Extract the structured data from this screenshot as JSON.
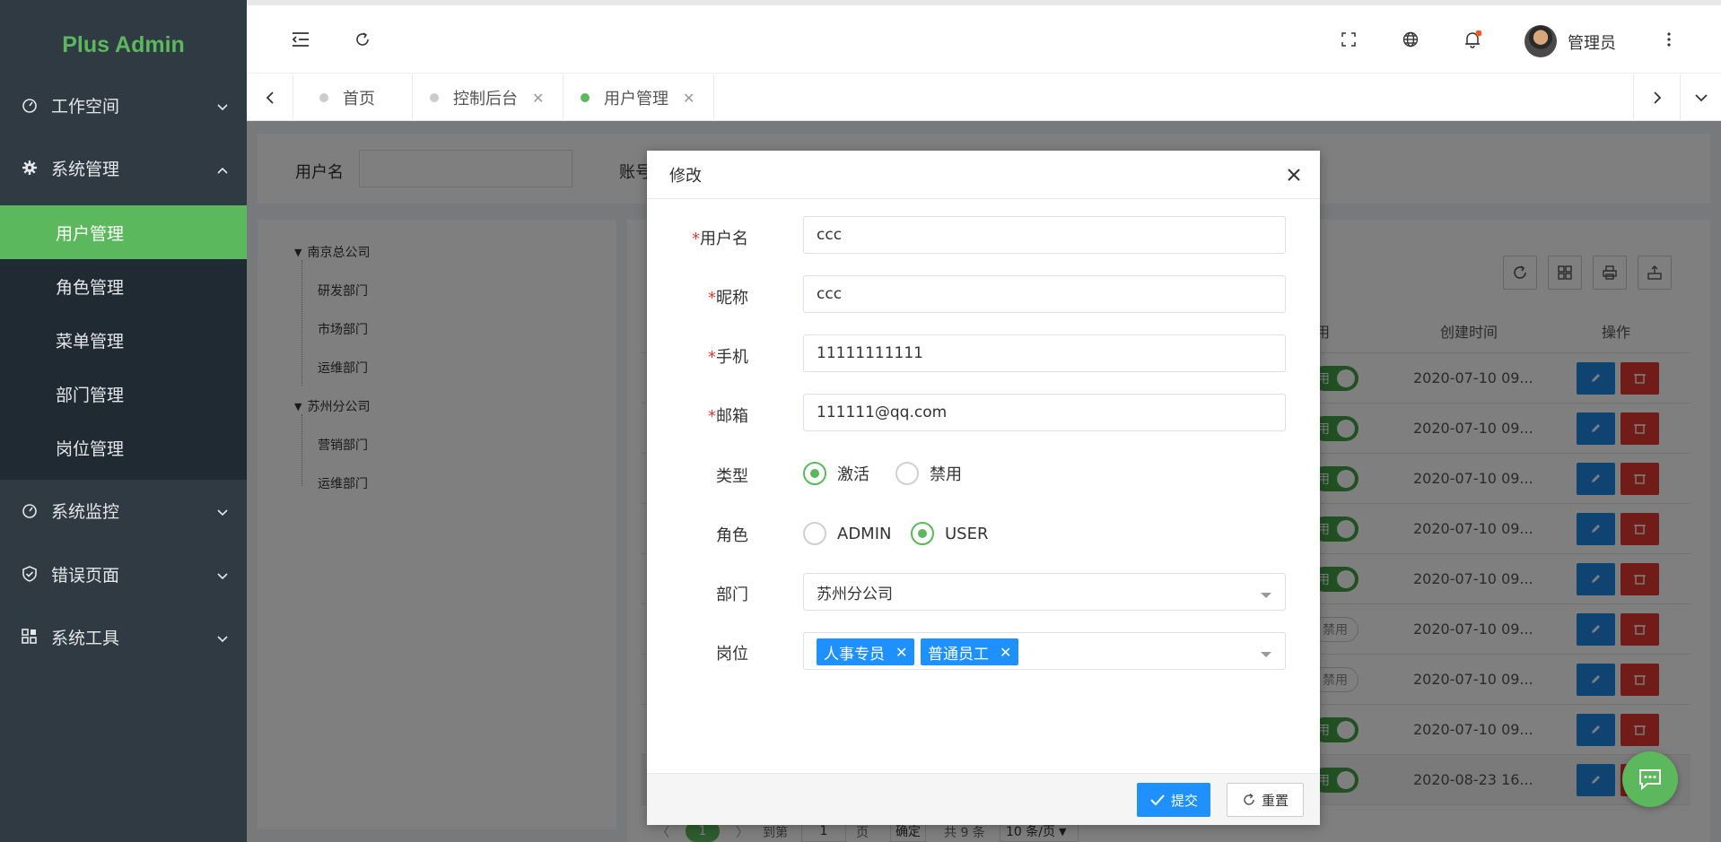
{
  "app": {
    "title": "Plus Admin"
  },
  "sidebar": {
    "groups": [
      {
        "label": "工作空间",
        "icon": "dashboard-icon",
        "expanded": false
      },
      {
        "label": "系统管理",
        "icon": "gear-icon",
        "expanded": true
      },
      {
        "label": "系统监控",
        "icon": "dashboard-icon",
        "expanded": false
      },
      {
        "label": "错误页面",
        "icon": "shield-icon",
        "expanded": false
      },
      {
        "label": "系统工具",
        "icon": "apps-icon",
        "expanded": false
      }
    ],
    "sub_items": [
      "用户管理",
      "角色管理",
      "菜单管理",
      "部门管理",
      "岗位管理"
    ],
    "active_sub": "用户管理"
  },
  "header": {
    "user_name": "管理员",
    "has_notification": true
  },
  "tabs": [
    {
      "label": "首页",
      "closable": false,
      "active": false
    },
    {
      "label": "控制后台",
      "closable": true,
      "active": false
    },
    {
      "label": "用户管理",
      "closable": true,
      "active": true
    }
  ],
  "search": {
    "username_label": "用户名",
    "account_label": "账号"
  },
  "tree": {
    "nodes": [
      {
        "label": "南京总公司",
        "children": [
          "研发部门",
          "市场部门",
          "运维部门"
        ]
      },
      {
        "label": "苏州分公司",
        "children": [
          "营销部门",
          "运维部门"
        ]
      }
    ]
  },
  "table": {
    "headers": {
      "enabled": "用",
      "created": "创建时间",
      "actions": "操作"
    },
    "rows": [
      {
        "enabled": true,
        "created": "2020-07-10 09..."
      },
      {
        "enabled": true,
        "created": "2020-07-10 09..."
      },
      {
        "enabled": true,
        "created": "2020-07-10 09..."
      },
      {
        "enabled": true,
        "created": "2020-07-10 09..."
      },
      {
        "enabled": true,
        "created": "2020-07-10 09..."
      },
      {
        "enabled": false,
        "created": "2020-07-10 09..."
      },
      {
        "enabled": false,
        "created": "2020-07-10 09..."
      },
      {
        "enabled": true,
        "created": "2020-07-10 09..."
      },
      {
        "enabled": true,
        "created": "2020-08-23 16..."
      }
    ],
    "switch_on_text": "用",
    "switch_off_text": "禁用"
  },
  "pagination": {
    "current": "1",
    "goto_label": "到第",
    "goto_value": "1",
    "page_suffix": "页",
    "confirm": "确定",
    "total": "共 9 条",
    "page_size": "10 条/页"
  },
  "modal": {
    "title": "修改",
    "fields": {
      "username": {
        "label": "用户名",
        "value": "ccc",
        "required": true
      },
      "nickname": {
        "label": "昵称",
        "value": "ccc",
        "required": true
      },
      "phone": {
        "label": "手机",
        "value": "11111111111",
        "required": true
      },
      "email": {
        "label": "邮箱",
        "value": "111111@qq.com",
        "required": true
      }
    },
    "type": {
      "label": "类型",
      "options": [
        "激活",
        "禁用"
      ],
      "selected": "激活"
    },
    "role": {
      "label": "角色",
      "options": [
        "ADMIN",
        "USER"
      ],
      "selected": "USER"
    },
    "dept": {
      "label": "部门",
      "value": "苏州分公司"
    },
    "post": {
      "label": "岗位",
      "tags": [
        "人事专员",
        "普通员工"
      ]
    },
    "submit": "提交",
    "reset": "重置"
  },
  "colors": {
    "accent": "#5cb85c",
    "sidebar": "#2f3a42",
    "primary": "#1e88e5",
    "danger": "#e53935"
  }
}
